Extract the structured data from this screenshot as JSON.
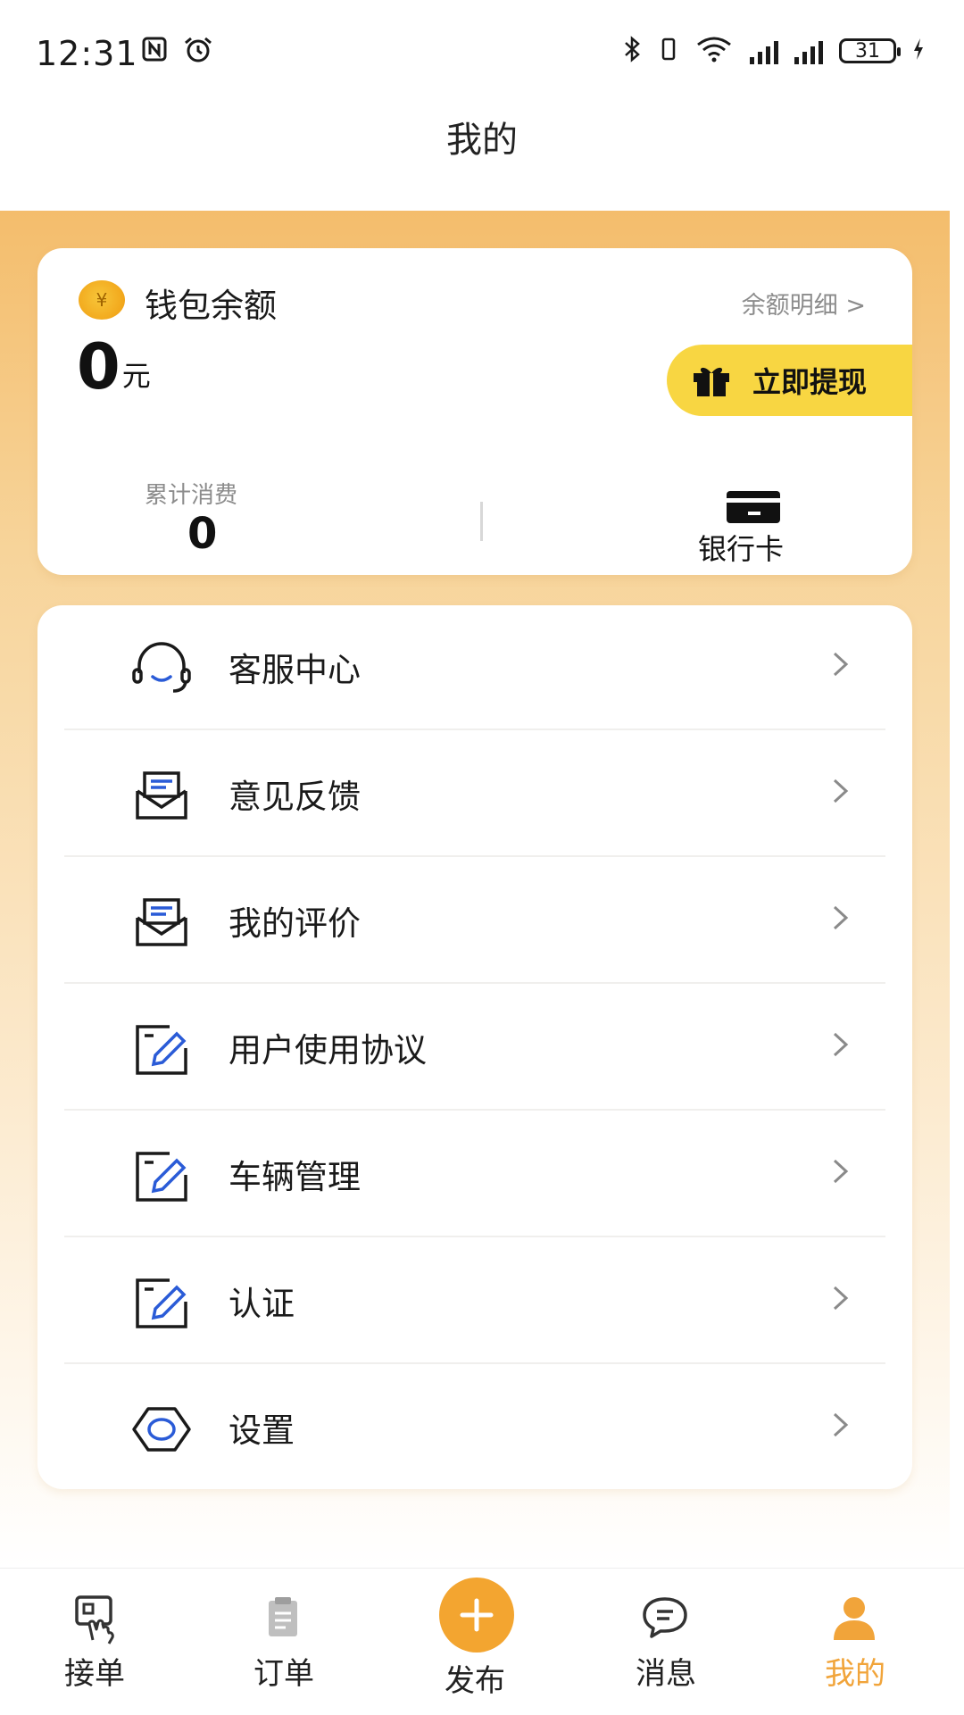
{
  "status_bar": {
    "time": "12:31",
    "battery_level": "31",
    "icons": [
      "nfc-icon",
      "alarm-icon",
      "bluetooth-icon",
      "vibrate-icon",
      "wifi-icon",
      "signal-icon",
      "signal-icon",
      "battery-icon",
      "charging-icon"
    ]
  },
  "header": {
    "title": "我的"
  },
  "wallet": {
    "title": "钱包余额",
    "detail_link": "余额明细 >",
    "balance": "0",
    "unit": "元",
    "withdraw_label": "立即提现",
    "cumulative_label": "累计消费",
    "cumulative_value": "0",
    "bank_card_label": "银行卡",
    "colors": {
      "withdraw_bg": "#f8d642",
      "coin": "#f2a81c"
    }
  },
  "menu": {
    "items": [
      {
        "label": "客服中心",
        "icon": "headset-icon"
      },
      {
        "label": "意见反馈",
        "icon": "feedback-mail-icon"
      },
      {
        "label": "我的评价",
        "icon": "review-mail-icon"
      },
      {
        "label": "用户使用协议",
        "icon": "edit-doc-icon"
      },
      {
        "label": "车辆管理",
        "icon": "edit-doc-icon"
      },
      {
        "label": "认证",
        "icon": "edit-doc-icon"
      },
      {
        "label": "设置",
        "icon": "settings-hex-icon"
      }
    ]
  },
  "bottom_nav": {
    "items": [
      {
        "label": "接单",
        "icon": "tap-order-icon",
        "active": false
      },
      {
        "label": "订单",
        "icon": "clipboard-icon",
        "active": false
      },
      {
        "label": "发布",
        "icon": "plus-circle-icon",
        "active": false
      },
      {
        "label": "消息",
        "icon": "chat-bubble-icon",
        "active": false
      },
      {
        "label": "我的",
        "icon": "person-icon",
        "active": true
      }
    ],
    "colors": {
      "active": "#f1a43a",
      "publish": "#f3a530"
    }
  }
}
